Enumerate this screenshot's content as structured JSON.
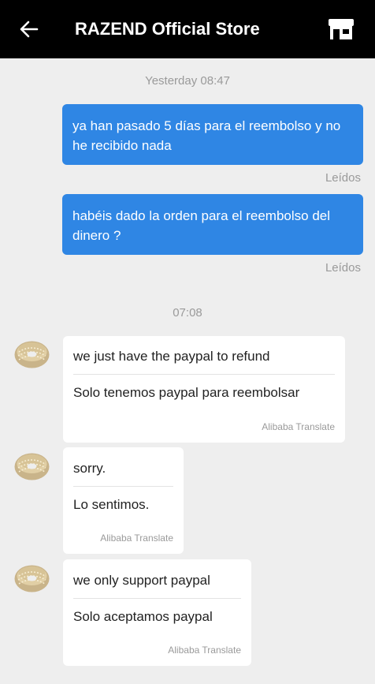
{
  "header": {
    "title": "RAZEND Official Store",
    "back_icon": "back-arrow-icon",
    "store_icon": "store-icon"
  },
  "colors": {
    "header_bg": "#000000",
    "outgoing_bubble": "#2f86e4",
    "background": "#eeeeee"
  },
  "timestamps": {
    "first": "Yesterday 08:47",
    "second": "07:08"
  },
  "outgoing": [
    {
      "text": "ya han pasado 5 días para el reembolso y no he recibido nada",
      "status": "Leídos"
    },
    {
      "text": "habéis dado la orden para el reembolso del dinero ?",
      "status": "Leídos"
    }
  ],
  "incoming": [
    {
      "original": "we just have the paypal to refund",
      "translated": "Solo tenemos paypal para reembolsar",
      "translator": "Alibaba Translate"
    },
    {
      "original": "sorry.",
      "translated": "Lo sentimos.",
      "translator": "Alibaba Translate"
    },
    {
      "original": "we only support paypal",
      "translated": "Solo aceptamos paypal",
      "translator": "Alibaba Translate"
    }
  ]
}
